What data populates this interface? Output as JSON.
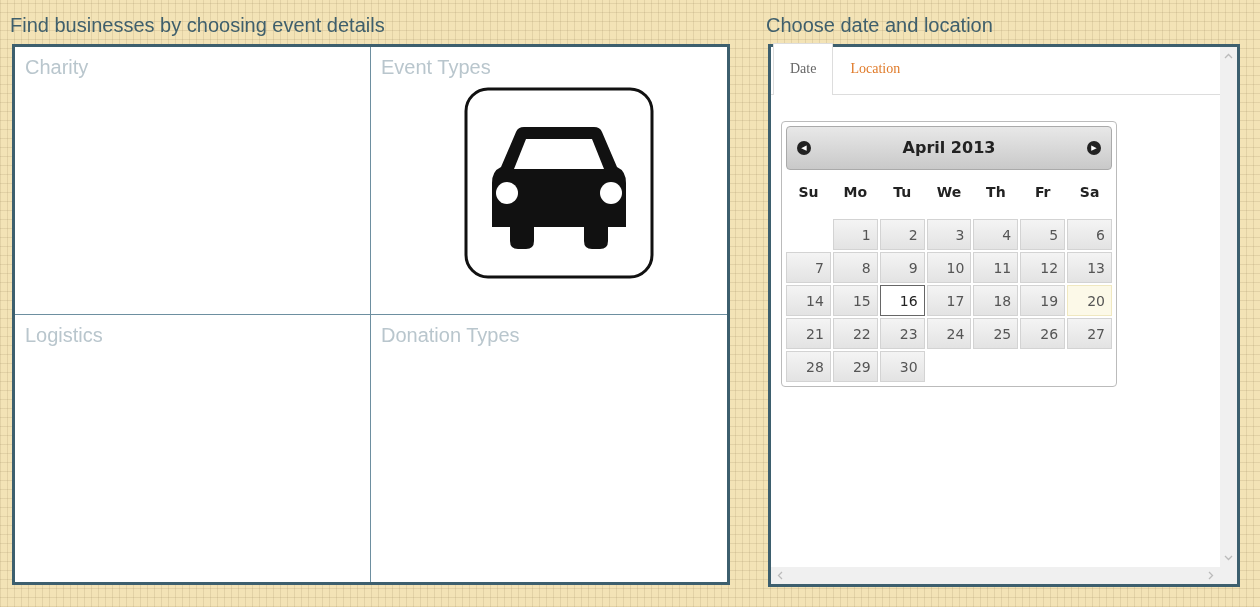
{
  "event_panel": {
    "title": "Find businesses by choosing event details",
    "quadrants": [
      {
        "label": "Charity",
        "kind": "empty"
      },
      {
        "label": "Event Types",
        "kind": "car"
      },
      {
        "label": "Logistics",
        "kind": "empty"
      },
      {
        "label": "Donation Types",
        "kind": "empty"
      }
    ]
  },
  "date_panel": {
    "title": "Choose date and location",
    "tabs": [
      {
        "label": "Date",
        "selected": true
      },
      {
        "label": "Location",
        "selected": false
      }
    ],
    "calendar": {
      "month": "April 2013",
      "prev": "◀",
      "next": "▶",
      "weekdays": [
        "Su",
        "Mo",
        "Tu",
        "We",
        "Th",
        "Fr",
        "Sa"
      ],
      "weeks": [
        [
          {
            "kind": "blank"
          },
          {
            "label": "1",
            "selected": false,
            "today": false
          },
          {
            "label": "2",
            "selected": false,
            "today": false
          },
          {
            "label": "3",
            "selected": false,
            "today": false
          },
          {
            "label": "4",
            "selected": false,
            "today": false
          },
          {
            "label": "5",
            "selected": false,
            "today": false
          },
          {
            "label": "6",
            "selected": false,
            "today": false
          }
        ],
        [
          {
            "label": "7",
            "selected": false,
            "today": false
          },
          {
            "label": "8",
            "selected": false,
            "today": false
          },
          {
            "label": "9",
            "selected": false,
            "today": false
          },
          {
            "label": "10",
            "selected": false,
            "today": false
          },
          {
            "label": "11",
            "selected": false,
            "today": false
          },
          {
            "label": "12",
            "selected": false,
            "today": false
          },
          {
            "label": "13",
            "selected": false,
            "today": false
          }
        ],
        [
          {
            "label": "14",
            "selected": false,
            "today": false
          },
          {
            "label": "15",
            "selected": false,
            "today": false
          },
          {
            "label": "16",
            "selected": true,
            "today": false
          },
          {
            "label": "17",
            "selected": false,
            "today": false
          },
          {
            "label": "18",
            "selected": false,
            "today": false
          },
          {
            "label": "19",
            "selected": false,
            "today": false
          },
          {
            "label": "20",
            "selected": false,
            "today": true
          }
        ],
        [
          {
            "label": "21",
            "selected": false,
            "today": false
          },
          {
            "label": "22",
            "selected": false,
            "today": false
          },
          {
            "label": "23",
            "selected": false,
            "today": false
          },
          {
            "label": "24",
            "selected": false,
            "today": false
          },
          {
            "label": "25",
            "selected": false,
            "today": false
          },
          {
            "label": "26",
            "selected": false,
            "today": false
          },
          {
            "label": "27",
            "selected": false,
            "today": false
          }
        ],
        [
          {
            "label": "28",
            "selected": false,
            "today": false
          },
          {
            "label": "29",
            "selected": false,
            "today": false
          },
          {
            "label": "30",
            "selected": false,
            "today": false
          },
          {
            "kind": "blank"
          },
          {
            "kind": "blank"
          },
          {
            "kind": "blank"
          },
          {
            "kind": "blank"
          }
        ]
      ]
    }
  }
}
